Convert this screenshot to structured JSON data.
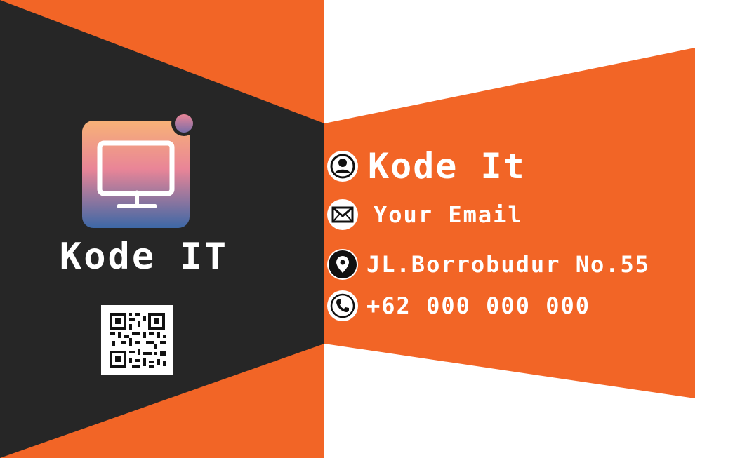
{
  "card": {
    "brand_left": "Kode IT",
    "name": "Kode It",
    "email": "Your Email",
    "address": "JL.Borrobudur No.55",
    "phone": "+62 000 000 000"
  },
  "icons": {
    "logo": "monitor-app-icon",
    "person": "person-icon",
    "email": "envelope-icon",
    "location": "location-pin-icon",
    "phone": "phone-icon",
    "qr": "qr-code"
  },
  "colors": {
    "orange": "#f26526",
    "dark": "#262626",
    "white": "#ffffff",
    "logo_gradient_top": "#f7b277",
    "logo_gradient_mid": "#e98597",
    "logo_gradient_bottom": "#3d68a6"
  }
}
